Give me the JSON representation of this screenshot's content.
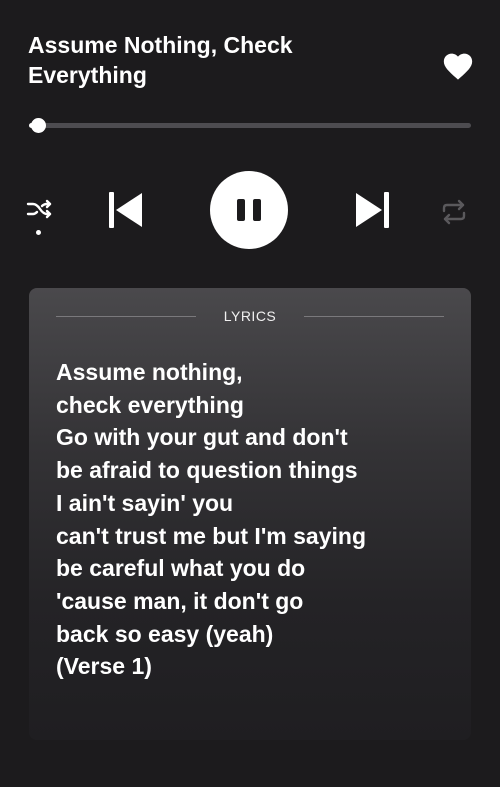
{
  "track": {
    "title": "Assume Nothing, Check Everything",
    "liked": true
  },
  "playback": {
    "progress_fraction": 0.02,
    "state": "playing",
    "shuffle_on": true,
    "repeat_on": false
  },
  "icons": {
    "like": "heart-icon",
    "shuffle": "shuffle-icon",
    "previous": "skip-previous-icon",
    "pause": "pause-icon",
    "next": "skip-next-icon",
    "repeat": "repeat-icon"
  },
  "colors": {
    "background": "#1c1b1d",
    "accent": "#ffffff",
    "inactive": "#5a595c"
  },
  "lyrics": {
    "label": "LYRICS",
    "lines": [
      "Assume nothing,",
      "check everything",
      "Go with your gut and don't",
      "be afraid to question things",
      "I ain't sayin' you",
      "can't trust me but I'm saying",
      "be careful what you do",
      "'cause man, it don't go",
      "back so easy (yeah)",
      "(Verse 1)"
    ]
  }
}
